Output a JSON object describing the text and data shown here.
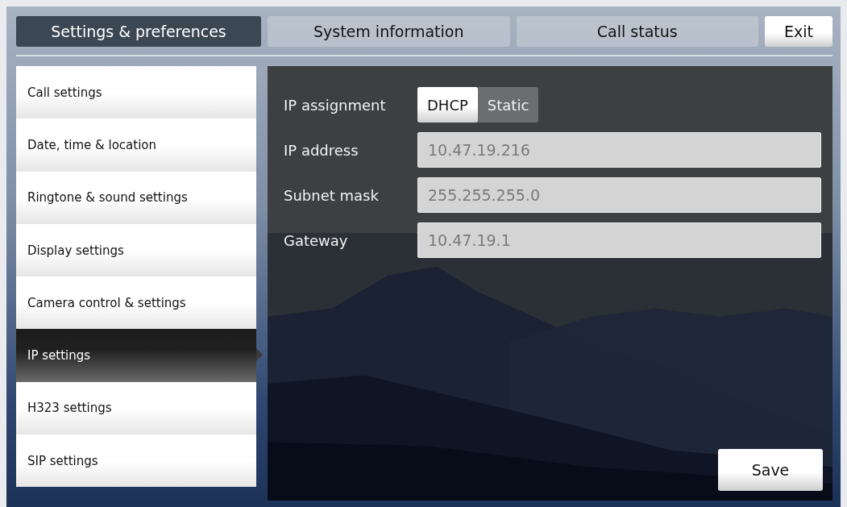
{
  "tabs": [
    {
      "label": "Settings & preferences",
      "selected": true
    },
    {
      "label": "System information",
      "selected": false
    },
    {
      "label": "Call status",
      "selected": false
    }
  ],
  "exit_button": "Exit",
  "sidebar": {
    "items": [
      {
        "label": "Call settings",
        "selected": false
      },
      {
        "label": "Date, time & location",
        "selected": false
      },
      {
        "label": "Ringtone & sound settings",
        "selected": false
      },
      {
        "label": "Display settings",
        "selected": false
      },
      {
        "label": "Camera control & settings",
        "selected": false
      },
      {
        "label": "IP settings",
        "selected": true
      },
      {
        "label": "H323 settings",
        "selected": false
      },
      {
        "label": "SIP settings",
        "selected": false
      }
    ]
  },
  "form": {
    "ip_assignment": {
      "label": "IP assignment",
      "options": [
        {
          "label": "DHCP",
          "selected": true
        },
        {
          "label": "Static",
          "selected": false
        }
      ]
    },
    "fields": [
      {
        "label": "IP address",
        "value": "10.47.19.216"
      },
      {
        "label": "Subnet mask",
        "value": "255.255.255.0"
      },
      {
        "label": "Gateway",
        "value": "10.47.19.1"
      }
    ]
  },
  "save_button": "Save"
}
